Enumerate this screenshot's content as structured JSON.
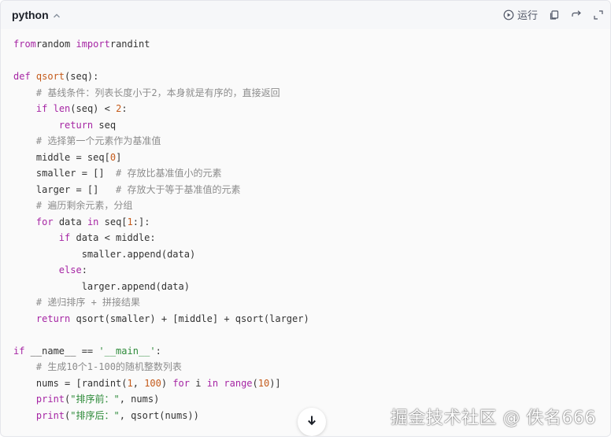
{
  "header": {
    "language": "python",
    "run_label": "运行"
  },
  "icons": {
    "collapse": "chevron-up-icon",
    "run": "play-circle-icon",
    "copy": "copy-icon",
    "insert": "arrow-return-icon",
    "expand": "expand-corner-icon",
    "scroll": "arrow-down-icon"
  },
  "code_lines": [
    [
      [
        "kw",
        "from"
      ],
      [
        "",
        "random "
      ],
      [
        "kw",
        "import"
      ],
      [
        "",
        "randint"
      ]
    ],
    [],
    [
      [
        "kw",
        "def "
      ],
      [
        "fn",
        "qsort"
      ],
      [
        "",
        "(seq):"
      ]
    ],
    [
      [
        "",
        "    "
      ],
      [
        "cm",
        "# 基线条件：列表长度小于2，本身就是有序的，直接返回"
      ]
    ],
    [
      [
        "",
        "    "
      ],
      [
        "kw",
        "if "
      ],
      [
        "bi",
        "len"
      ],
      [
        "",
        "(seq) < "
      ],
      [
        "nm",
        "2"
      ],
      [
        "",
        ":"
      ]
    ],
    [
      [
        "",
        "        "
      ],
      [
        "kw",
        "return"
      ],
      [
        "",
        " seq"
      ]
    ],
    [
      [
        "",
        "    "
      ],
      [
        "cm",
        "# 选择第一个元素作为基准值"
      ]
    ],
    [
      [
        "",
        "    middle = seq["
      ],
      [
        "nm",
        "0"
      ],
      [
        "",
        "]"
      ]
    ],
    [
      [
        "",
        "    smaller = []  "
      ],
      [
        "cm",
        "# 存放比基准值小的元素"
      ]
    ],
    [
      [
        "",
        "    larger = []   "
      ],
      [
        "cm",
        "# 存放大于等于基准值的元素"
      ]
    ],
    [
      [
        "",
        "    "
      ],
      [
        "cm",
        "# 遍历剩余元素，分组"
      ]
    ],
    [
      [
        "",
        "    "
      ],
      [
        "kw",
        "for"
      ],
      [
        "",
        " data "
      ],
      [
        "kw",
        "in"
      ],
      [
        "",
        " seq["
      ],
      [
        "nm",
        "1"
      ],
      [
        "",
        ":]:"
      ]
    ],
    [
      [
        "",
        "        "
      ],
      [
        "kw",
        "if"
      ],
      [
        "",
        " data < middle:"
      ]
    ],
    [
      [
        "",
        "            smaller.append(data)"
      ]
    ],
    [
      [
        "",
        "        "
      ],
      [
        "kw",
        "else"
      ],
      [
        "",
        ":"
      ]
    ],
    [
      [
        "",
        "            larger.append(data)"
      ]
    ],
    [
      [
        "",
        "    "
      ],
      [
        "cm",
        "# 递归排序 + 拼接结果"
      ]
    ],
    [
      [
        "",
        "    "
      ],
      [
        "kw",
        "return"
      ],
      [
        "",
        " qsort(smaller) + [middle] + qsort(larger)"
      ]
    ],
    [],
    [
      [
        "kw",
        "if"
      ],
      [
        "",
        " __name__ == "
      ],
      [
        "st",
        "'__main__'"
      ],
      [
        "",
        ":"
      ]
    ],
    [
      [
        "",
        "    "
      ],
      [
        "cm",
        "# 生成10个1-100的随机整数列表"
      ]
    ],
    [
      [
        "",
        "    nums = [randint("
      ],
      [
        "nm",
        "1"
      ],
      [
        "",
        ", "
      ],
      [
        "nm",
        "100"
      ],
      [
        "",
        ") "
      ],
      [
        "kw",
        "for"
      ],
      [
        "",
        " i "
      ],
      [
        "kw",
        "in"
      ],
      [
        "",
        "",
        " "
      ],
      [
        "bi",
        "range"
      ],
      [
        "",
        "("
      ],
      [
        "nm",
        "10"
      ],
      [
        "",
        ")]"
      ]
    ],
    [
      [
        "",
        "    "
      ],
      [
        "bi",
        "print"
      ],
      [
        "",
        "("
      ],
      [
        "st",
        "\"排序前：\""
      ],
      [
        "",
        ", nums)"
      ]
    ],
    [
      [
        "",
        "    "
      ],
      [
        "bi",
        "print"
      ],
      [
        "",
        "("
      ],
      [
        "st",
        "\"排序后：\""
      ],
      [
        "",
        ", qsort(nums))"
      ]
    ]
  ],
  "watermark": "掘金技术社区 @ 佚名666",
  "colors": {
    "keyword": "#a626a4",
    "function": "#c45a1a",
    "comment": "#8c8c8c",
    "string": "#2e8b3a"
  }
}
